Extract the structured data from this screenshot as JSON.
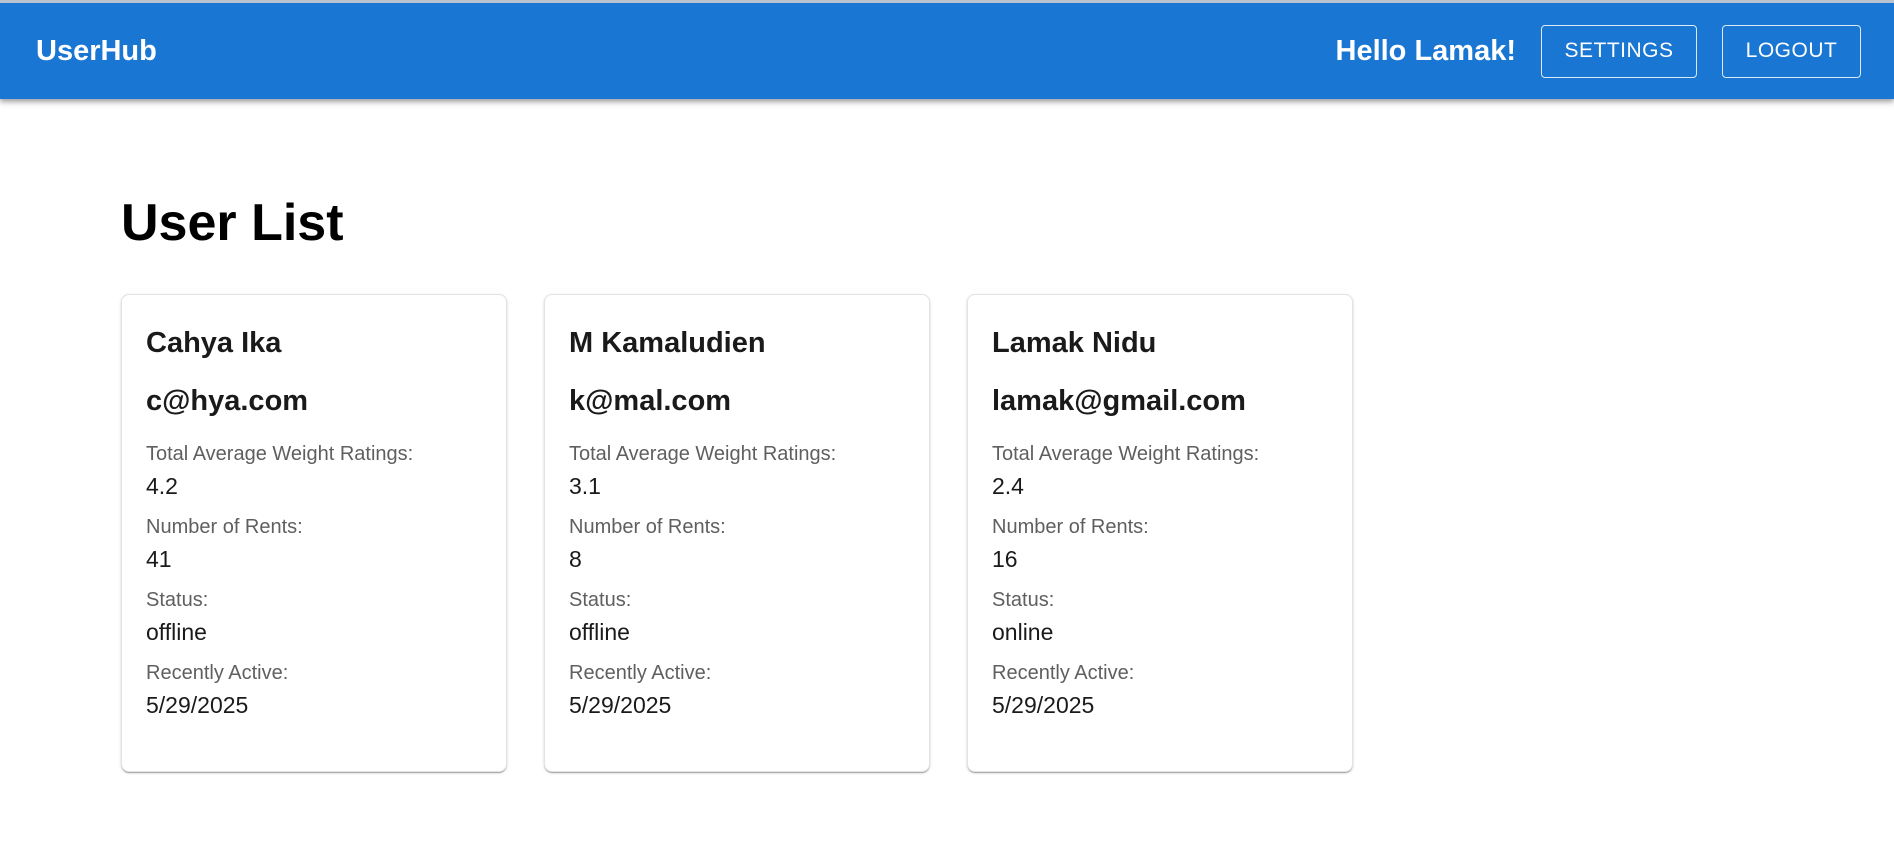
{
  "header": {
    "brand": "UserHub",
    "greeting": "Hello Lamak!",
    "settings_label": "SETTINGS",
    "logout_label": "LOGOUT",
    "color": "#1976d2"
  },
  "main": {
    "title": "User List",
    "labels": {
      "rating": "Total Average Weight Ratings:",
      "rents": "Number of Rents:",
      "status": "Status:",
      "recent": "Recently Active:"
    },
    "users": [
      {
        "name": "Cahya Ika",
        "email": "c@hya.com",
        "rating": "4.2",
        "rents": "41",
        "status": "offline",
        "recent": "5/29/2025"
      },
      {
        "name": "M Kamaludien",
        "email": "k@mal.com",
        "rating": "3.1",
        "rents": "8",
        "status": "offline",
        "recent": "5/29/2025"
      },
      {
        "name": "Lamak Nidu",
        "email": "lamak@gmail.com",
        "rating": "2.4",
        "rents": "16",
        "status": "online",
        "recent": "5/29/2025"
      }
    ]
  }
}
